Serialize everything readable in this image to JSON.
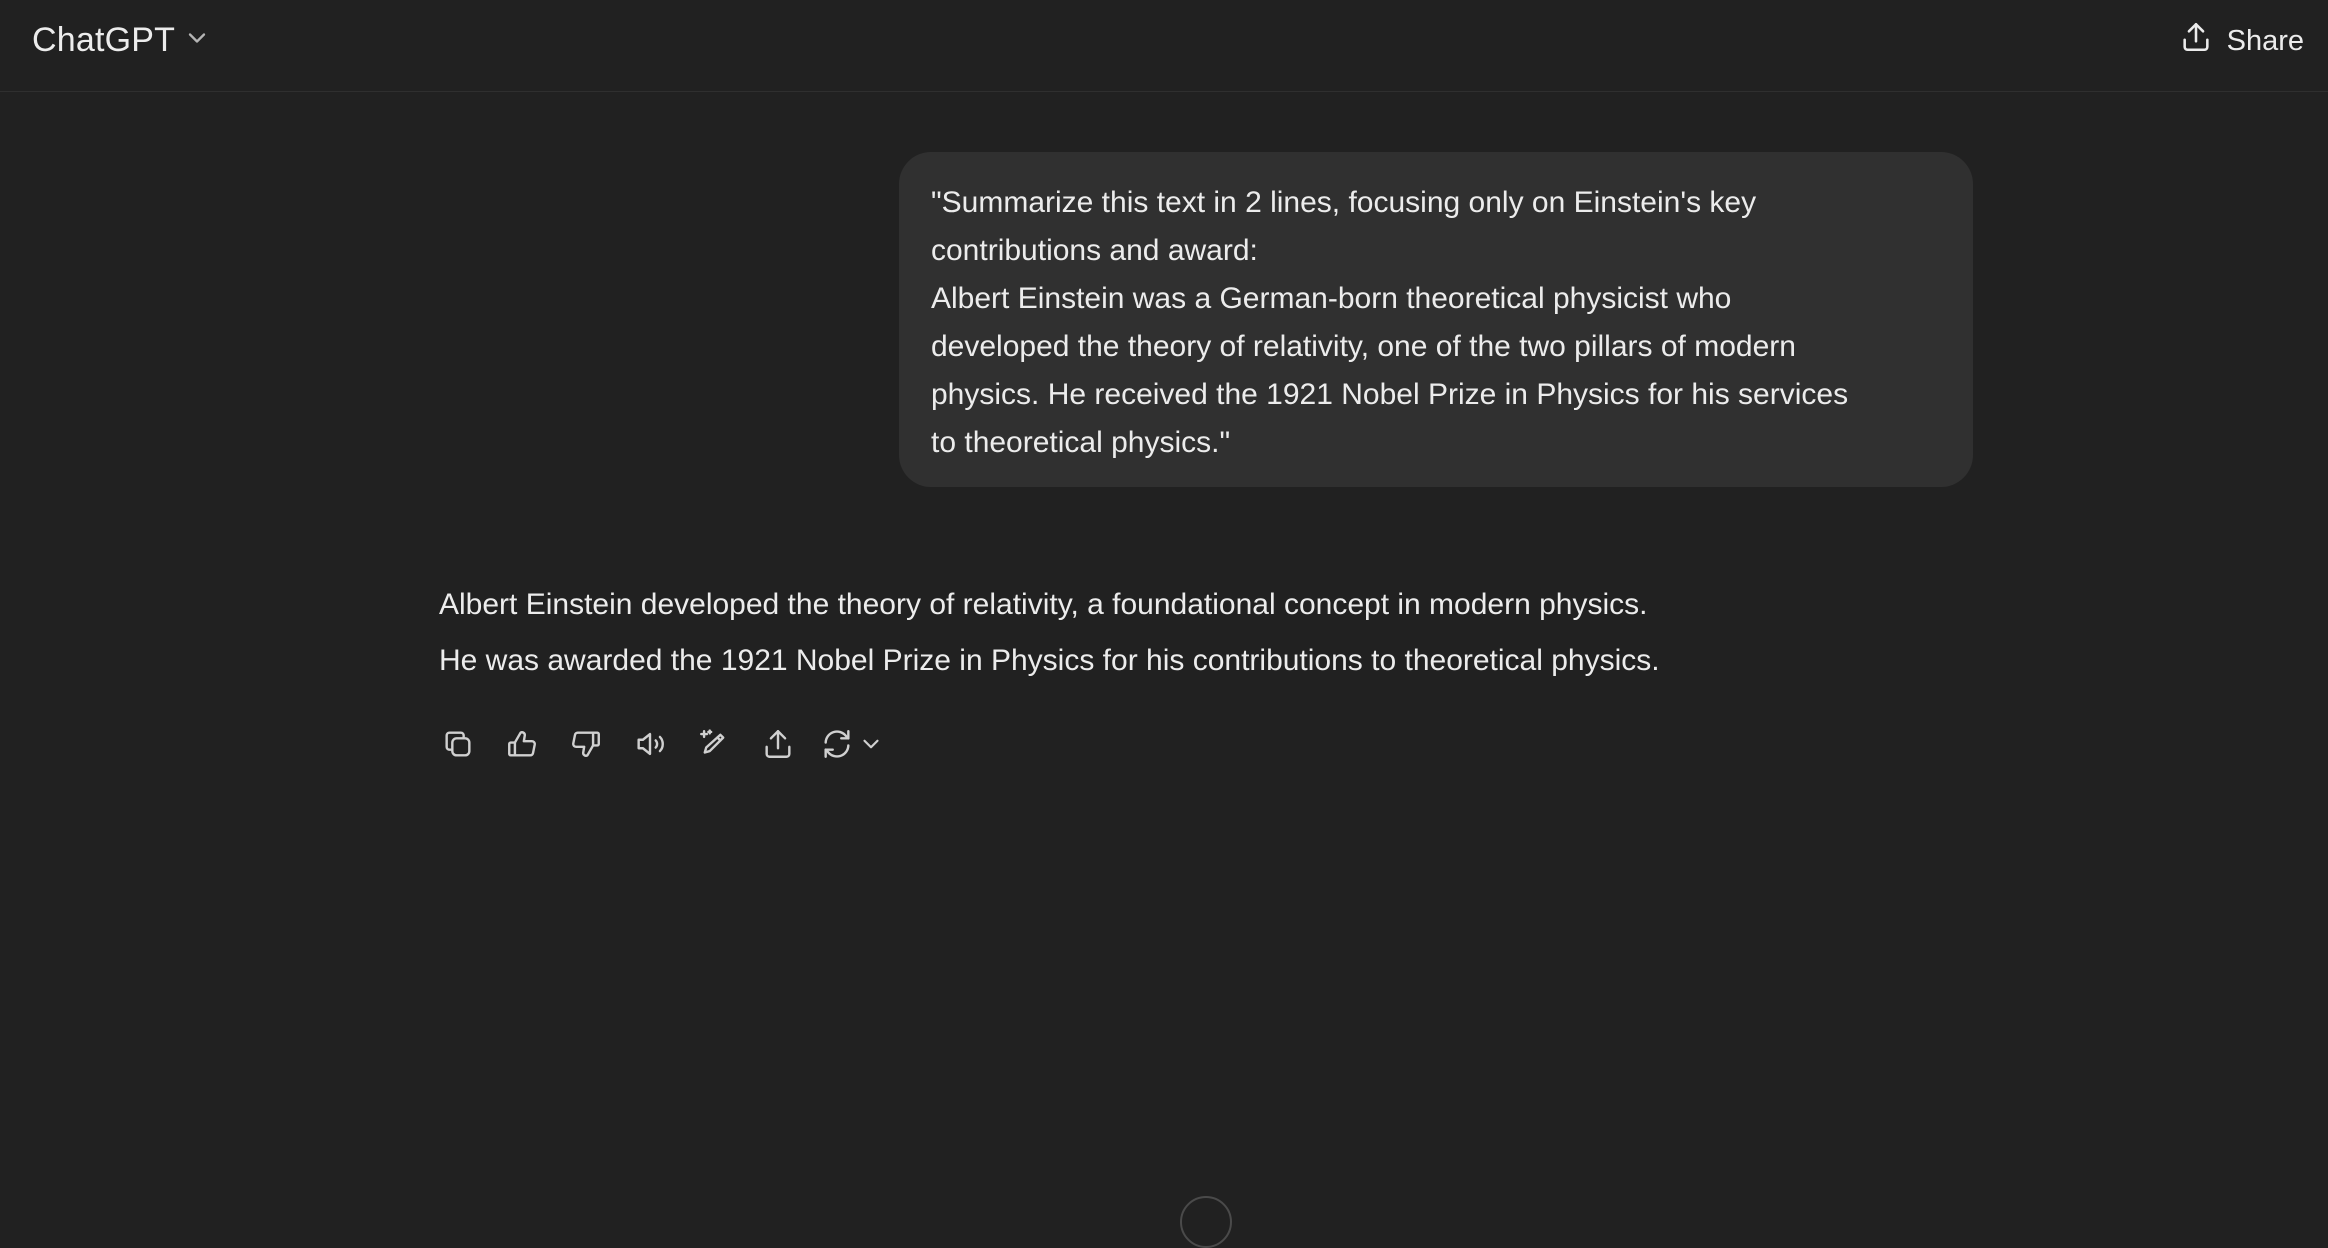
{
  "header": {
    "model_name": "ChatGPT",
    "share_label": "Share"
  },
  "conversation": {
    "user_message": "\"Summarize this text in 2 lines, focusing only on Einstein's key\ncontributions and award:\nAlbert Einstein was a German-born theoretical physicist who\ndeveloped the theory of relativity, one of the two pillars of modern\nphysics. He received the 1921 Nobel Prize in Physics for his services\nto theoretical physics.\"",
    "assistant_lines": [
      "Albert Einstein developed the theory of relativity, a foundational concept in modern physics.",
      "He was awarded the 1921 Nobel Prize in Physics for his contributions to theoretical physics."
    ]
  },
  "actions": [
    {
      "name": "copy-icon"
    },
    {
      "name": "thumbs-up-icon"
    },
    {
      "name": "thumbs-down-icon"
    },
    {
      "name": "read-aloud-icon"
    },
    {
      "name": "edit-in-canvas-icon"
    },
    {
      "name": "share-icon"
    },
    {
      "name": "regenerate-icon"
    }
  ]
}
